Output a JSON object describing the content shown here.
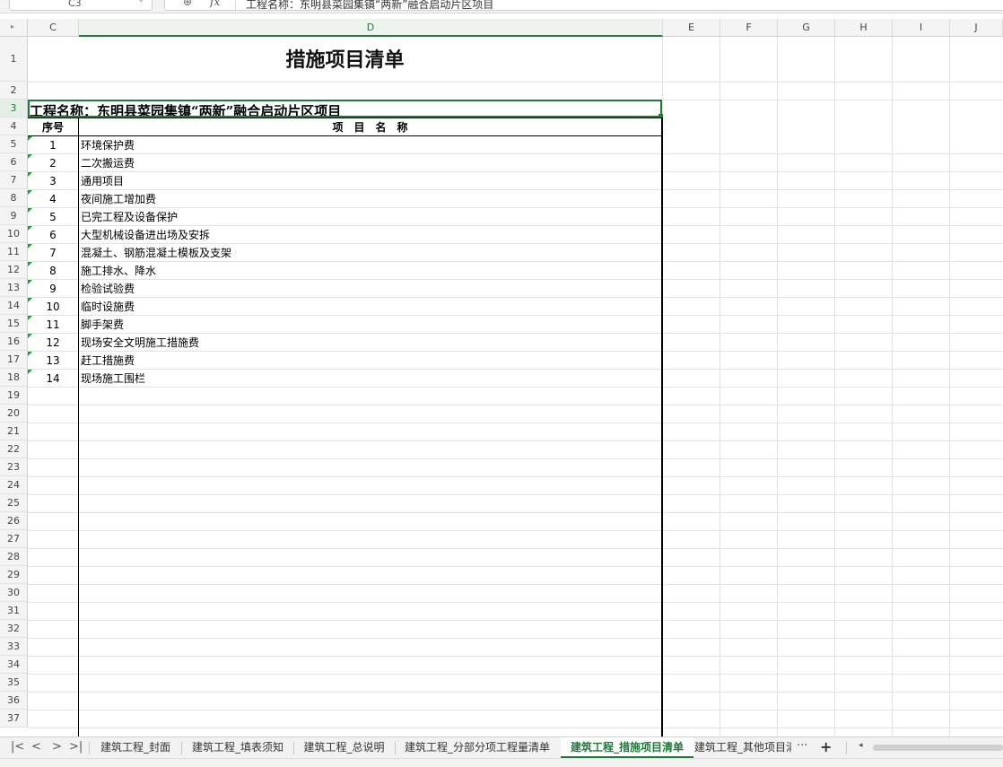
{
  "formula_bar": {
    "cell_ref": "C3",
    "formula_text": "工程名称：东明县菜园集镇“两新”融合启动片区项目"
  },
  "columns": [
    "C",
    "D",
    "E",
    "F",
    "G",
    "H",
    "I",
    "J"
  ],
  "rows": [
    "1",
    "2",
    "3",
    "4",
    "5",
    "6",
    "7",
    "8",
    "9",
    "10",
    "11",
    "12",
    "13",
    "14",
    "15",
    "16",
    "17",
    "18",
    "19",
    "20",
    "21",
    "22",
    "23",
    "24",
    "25",
    "26",
    "27",
    "28",
    "29",
    "30",
    "31",
    "32",
    "33",
    "34",
    "35",
    "36",
    "37"
  ],
  "sheet": {
    "title": "措施项目清单",
    "project_name": "工程名称：东明县菜园集镇“两新”融合启动片区项目",
    "headers": {
      "seq": "序号",
      "name": "项　目　名　称"
    },
    "items": [
      {
        "seq": "1",
        "name": "环境保护费"
      },
      {
        "seq": "2",
        "name": "二次搬运费"
      },
      {
        "seq": "3",
        "name": "通用项目"
      },
      {
        "seq": "4",
        "name": "夜间施工增加费"
      },
      {
        "seq": "5",
        "name": "已完工程及设备保护"
      },
      {
        "seq": "6",
        "name": "大型机械设备进出场及安拆"
      },
      {
        "seq": "7",
        "name": "混凝土、钢筋混凝土模板及支架"
      },
      {
        "seq": "8",
        "name": "施工排水、降水"
      },
      {
        "seq": "9",
        "name": "检验试验费"
      },
      {
        "seq": "10",
        "name": "临时设施费"
      },
      {
        "seq": "11",
        "name": "脚手架费"
      },
      {
        "seq": "12",
        "name": "现场安全文明施工措施费"
      },
      {
        "seq": "13",
        "name": "赶工措施费"
      },
      {
        "seq": "14",
        "name": "现场施工围栏"
      }
    ]
  },
  "tabs": [
    {
      "label": "建筑工程_封面",
      "active": false
    },
    {
      "label": "建筑工程_填表须知",
      "active": false
    },
    {
      "label": "建筑工程_总说明",
      "active": false
    },
    {
      "label": "建筑工程_分部分项工程量清单",
      "active": false
    },
    {
      "label": "建筑工程_措施项目清单",
      "active": true
    },
    {
      "label": "建筑工程_其他项目清",
      "active": false
    }
  ],
  "tab_more": "···",
  "tab_add": "+",
  "accent_color": "#1f7a3a"
}
